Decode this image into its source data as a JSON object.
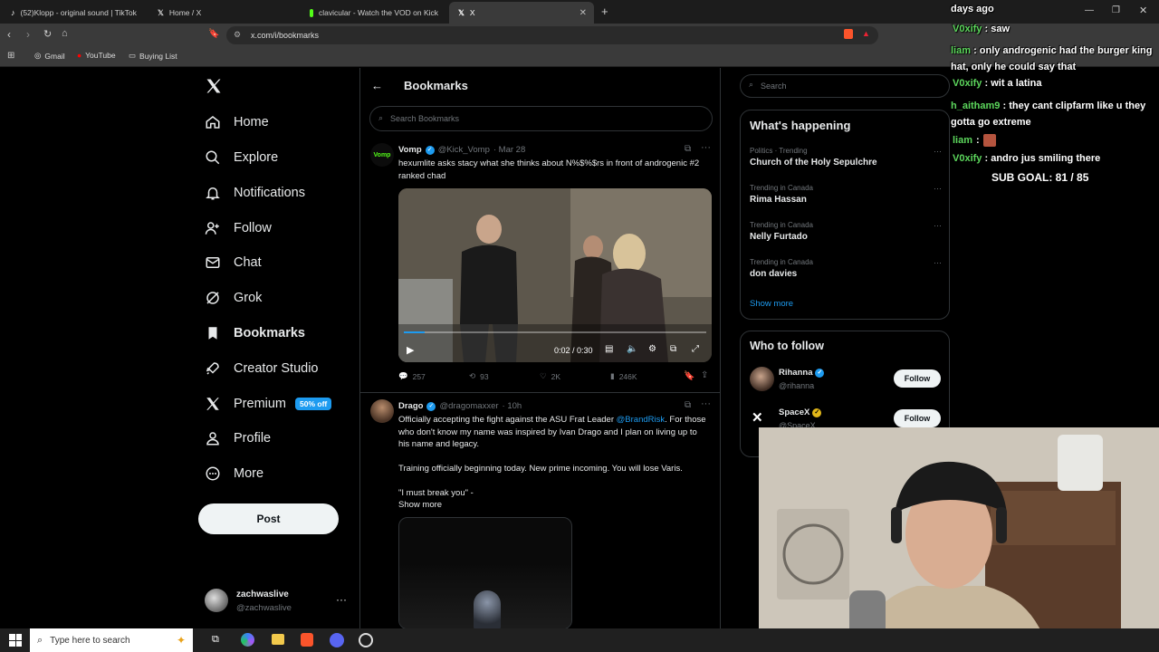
{
  "browser": {
    "tabs": [
      {
        "title": "(52)Klopp - original sound | TikTok",
        "icon": "tiktok-icon"
      },
      {
        "title": "Home / X",
        "icon": "x-logo-icon"
      },
      {
        "title": "clavicular - Watch the VOD on Kick",
        "icon": "kick-icon"
      },
      {
        "title": "X",
        "icon": "x-logo-icon",
        "active": true
      }
    ],
    "url": "x.com/i/bookmarks",
    "bookmarks": [
      "Gmail",
      "YouTube",
      "Buying List"
    ]
  },
  "left_nav": {
    "items": [
      {
        "label": "Home",
        "icon": "home-icon"
      },
      {
        "label": "Explore",
        "icon": "search-icon"
      },
      {
        "label": "Notifications",
        "icon": "bell-icon"
      },
      {
        "label": "Follow",
        "icon": "add-person-icon"
      },
      {
        "label": "Chat",
        "icon": "mail-icon"
      },
      {
        "label": "Grok",
        "icon": "grok-icon"
      },
      {
        "label": "Bookmarks",
        "icon": "bookmark-icon"
      },
      {
        "label": "Creator Studio",
        "icon": "rocket-icon"
      },
      {
        "label": "Premium",
        "icon": "x-logo-icon"
      },
      {
        "label": "Profile",
        "icon": "person-icon"
      },
      {
        "label": "More",
        "icon": "more-circle-icon"
      }
    ],
    "premium_badge": "50% off",
    "post_button": "Post",
    "account": {
      "name": "zachwaslive",
      "handle": "@zachwaslive"
    }
  },
  "bookmarks_page": {
    "title": "Bookmarks",
    "search_placeholder": "Search Bookmarks"
  },
  "tweets": [
    {
      "avatar_text": "Vomp",
      "name": "Vomp",
      "handle": "@Kick_Vomp",
      "time": "· Mar 28",
      "text": "hexumlite asks stacy what she thinks about N%$%$rs in front of androgenic #2 ranked chad",
      "video_time": "0:02 / 0:30",
      "video_progress": 0.07,
      "stats": {
        "replies": "257",
        "reposts": "93",
        "likes": "2K",
        "views": "246K"
      }
    },
    {
      "name": "Drago",
      "handle": "@dragomaxxer",
      "time": "· 10h",
      "text_pre": "Officially accepting the fight against the ASU Frat Leader ",
      "mention": "@BrandRisk",
      "text_post": ". For those who don't know my name was inspired by Ivan Drago and I plan on living up to his name and legacy.",
      "line2": "Training officially beginning today. New prime incoming. You will lose Varis.",
      "line3": "\"I must break you\" -",
      "show_more": "Show more"
    }
  ],
  "right": {
    "search_placeholder": "Search",
    "whats_happening": "What's happening",
    "trends": [
      {
        "context": "Politics · Trending",
        "title": "Church of the Holy Sepulchre"
      },
      {
        "context": "Trending in Canada",
        "title": "Rima Hassan"
      },
      {
        "context": "Trending in Canada",
        "title": "Nelly Furtado"
      },
      {
        "context": "Trending in Canada",
        "title": "don davies"
      }
    ],
    "show_more": "Show more",
    "who_to_follow": "Who to follow",
    "follow_suggestions": [
      {
        "name": "Rihanna",
        "handle": "@rihanna",
        "button": "Follow"
      },
      {
        "name": "SpaceX",
        "handle": "@SpaceX",
        "button": "Follow"
      }
    ]
  },
  "chat_overlay": {
    "messages": [
      {
        "user": "",
        "text": "days ago"
      },
      {
        "user": "V0xify",
        "text": ": saw"
      },
      {
        "user": "liam",
        "text": ": only androgenic had the burger king hat, only he could say that"
      },
      {
        "user": "V0xify",
        "text": ": wit a latina"
      },
      {
        "user": "h_aitham9",
        "text": ": they cant clipfarm like u they gotta go extreme"
      },
      {
        "user": "liam",
        "text": ":"
      },
      {
        "user": "V0xify",
        "text": ": andro jus smiling there"
      }
    ],
    "sub_goal": "SUB GOAL: 81 / 85"
  },
  "taskbar": {
    "search_placeholder": "Type here to search"
  }
}
